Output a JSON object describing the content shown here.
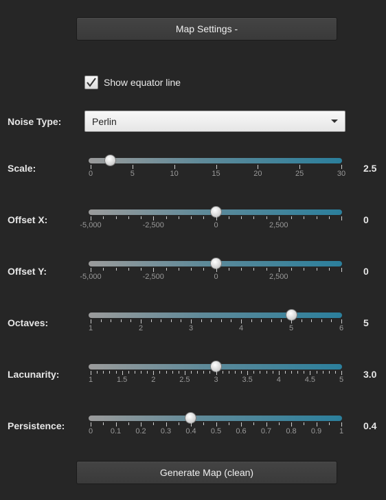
{
  "header": {
    "map_settings_label": "Map Settings -"
  },
  "equator": {
    "label": "Show equator line",
    "checked": true
  },
  "noise": {
    "label": "Noise Type:",
    "selected": "Perlin"
  },
  "sliders": [
    {
      "key": "scale",
      "label": "Scale:",
      "min": 0,
      "max": 30,
      "value": 2.5,
      "display": "2.5",
      "ticks": [
        "0",
        "5",
        "10",
        "15",
        "20",
        "25",
        "30"
      ],
      "minor_per_major": 0
    },
    {
      "key": "offset-x",
      "label": "Offset X:",
      "min": -5000,
      "max": 5000,
      "value": 0,
      "display": "0",
      "ticks": [
        "-5,000",
        "-2,500",
        "0",
        "2,500",
        ""
      ],
      "minor_per_major": 4
    },
    {
      "key": "offset-y",
      "label": "Offset Y:",
      "min": -5000,
      "max": 5000,
      "value": 0,
      "display": "0",
      "ticks": [
        "-5,000",
        "-2,500",
        "0",
        "2,500",
        ""
      ],
      "minor_per_major": 4
    },
    {
      "key": "octaves",
      "label": "Octaves:",
      "min": 1,
      "max": 6,
      "value": 5,
      "display": "5",
      "ticks": [
        "1",
        "2",
        "3",
        "4",
        "5",
        "6"
      ],
      "minor_per_major": 4
    },
    {
      "key": "lacunarity",
      "label": "Lacunarity:",
      "min": 1,
      "max": 5,
      "value": 3,
      "display": "3.0",
      "ticks": [
        "1",
        "1.5",
        "2",
        "2.5",
        "3",
        "3.5",
        "4",
        "4.5",
        "5"
      ],
      "minor_per_major": 4
    },
    {
      "key": "persistence",
      "label": "Persistence:",
      "min": 0,
      "max": 1,
      "value": 0.4,
      "display": "0.4",
      "ticks": [
        "0",
        "0.1",
        "0.2",
        "0.3",
        "0.4",
        "0.5",
        "0.6",
        "0.7",
        "0.8",
        "0.9",
        "1"
      ],
      "minor_per_major": 1
    }
  ],
  "footer": {
    "generate_label": "Generate Map (clean)"
  }
}
